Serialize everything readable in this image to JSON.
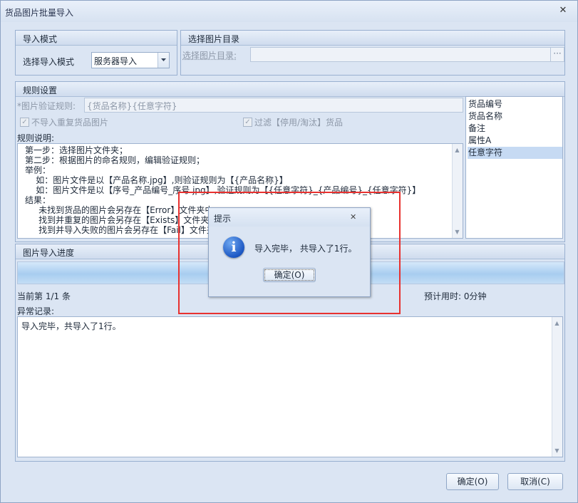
{
  "window": {
    "title": "货品图片批量导入",
    "close_glyph": "✕"
  },
  "import_mode": {
    "group_title": "导入模式",
    "label": "选择导入模式",
    "selected": "服务器导入"
  },
  "image_dir": {
    "group_title": "选择图片目录",
    "label": "选择图片目录:",
    "value": "",
    "browse_label": "···"
  },
  "rules": {
    "group_title": "规则设置",
    "verify_label": "*图片验证规则:",
    "verify_value": "{货品名称}{任意字符}",
    "no_duplicate_label": "不导入重复货品图片",
    "filter_label": "过滤【停用/淘汰】货品",
    "desc_label": "规则说明:",
    "desc_lines": [
      "第一步：选择图片文件夹；",
      "第二步：根据图片的命名规则，编辑验证规则；",
      "举例：",
      "    如：图片文件是以【产品名称.jpg】,则验证规则为【{产品名称}】",
      "    如：图片文件是以【序号_产品编号_序号.jpg】,验证规则为【{任意字符}_{产品编号}_{任意字符}】",
      "结果：",
      "     未找到货品的图片会另存在【Error】文件夹中",
      "     找到并重复的图片会另存在【Exists】文件夹中",
      "     找到并导入失败的图片会另存在【Fail】文件夹中"
    ],
    "field_list": [
      "货品编号",
      "货品名称",
      "备注",
      "属性A",
      "任意字符"
    ],
    "selected_field": "任意字符"
  },
  "progress": {
    "group_title": "图片导入进度",
    "progress_fraction": 1.0,
    "current_label": "当前第 1/1 条",
    "eta_label": "预计用时: 0分钟",
    "error_label": "异常记录:",
    "log_text": "导入完毕，共导入了1行。"
  },
  "footer": {
    "ok_label": "确定(O)",
    "cancel_label": "取消(C)"
  },
  "popup": {
    "title": "提示",
    "close_glyph": "✕",
    "message": "导入完毕， 共导入了1行。",
    "ok_label": "确定(O)",
    "info_glyph": "i"
  },
  "colors": {
    "highlight_border": "#e8312f",
    "progress_fill": "#a8cdf0"
  }
}
